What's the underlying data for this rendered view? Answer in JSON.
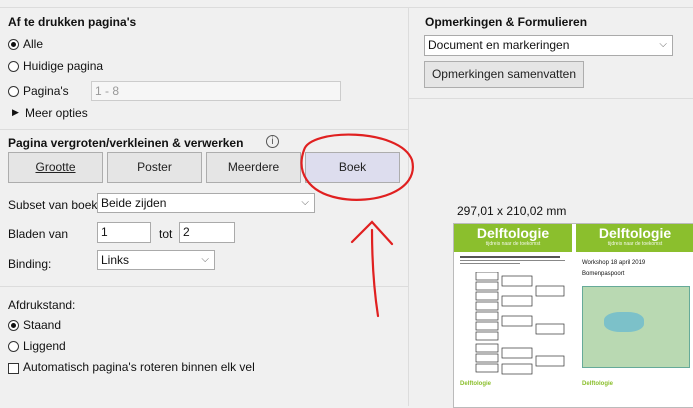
{
  "print_pages": {
    "title": "Af te drukken pagina's",
    "all": "Alle",
    "current": "Huidige pagina",
    "pages": "Pagina's",
    "pages_value": "1 - 8",
    "more": "Meer opties"
  },
  "scaling": {
    "title": "Pagina vergroten/verkleinen & verwerken",
    "info_icon": "i",
    "buttons": [
      "Grootte",
      "Poster",
      "Meerdere",
      "Boek"
    ],
    "subset_label": "Subset van boek:",
    "subset_value": "Beide zijden",
    "sheets_label": "Bladen van",
    "sheets_from": "1",
    "sheets_to_label": "tot",
    "sheets_to": "2",
    "binding_label": "Binding:",
    "binding_value": "Links"
  },
  "orientation": {
    "title": "Afdrukstand:",
    "portrait": "Staand",
    "landscape": "Liggend",
    "auto_rotate": "Automatisch pagina's roteren binnen elk vel"
  },
  "comments": {
    "title": "Opmerkingen & Formulieren",
    "select_value": "Document en markeringen",
    "summarize": "Opmerkingen samenvatten"
  },
  "preview": {
    "size": "297,01 x 210,02 mm",
    "brand": "Delftologie",
    "tagline": "tijdreis naar de toekomst",
    "workshop": "Workshop 18 april 2019",
    "passport": "Bomenpaspoort",
    "footer_brand": "Delftologie"
  },
  "colors": {
    "brand_green": "#8bbf2d",
    "annotation_red": "#e02020"
  }
}
